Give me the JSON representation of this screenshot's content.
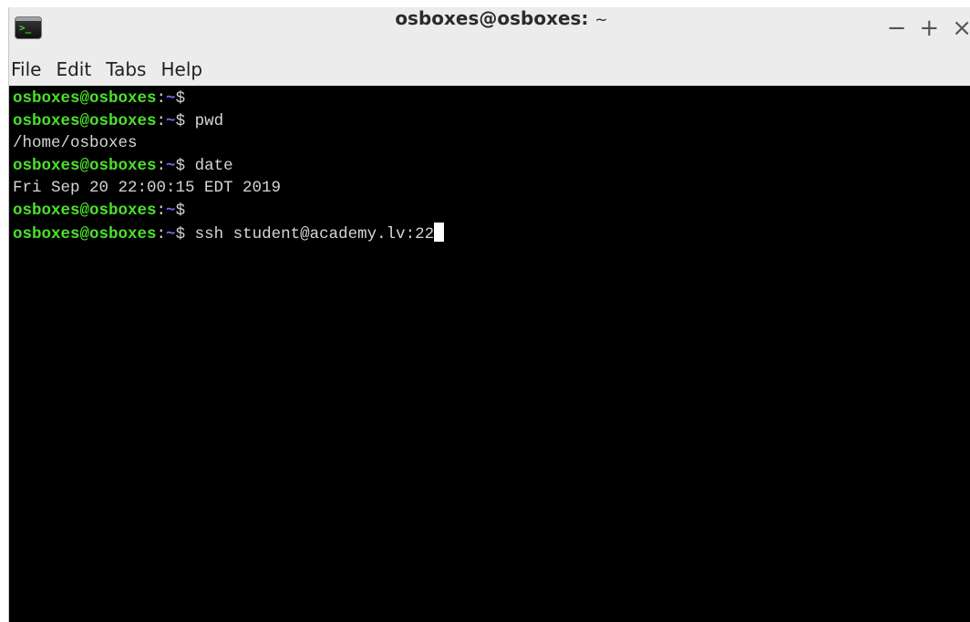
{
  "window": {
    "title_main": "osboxes@osboxes:",
    "title_suffix": "~",
    "controls": {
      "minimize": "−",
      "maximize": "+",
      "close": "×"
    }
  },
  "menu": {
    "file": "File",
    "edit": "Edit",
    "tabs": "Tabs",
    "help": "Help"
  },
  "terminal": {
    "prompt": {
      "user_host": "osboxes@osboxes",
      "separator": ":",
      "path": "~",
      "symbol": "$"
    },
    "lines": [
      {
        "type": "prompt",
        "command": ""
      },
      {
        "type": "prompt",
        "command": " pwd"
      },
      {
        "type": "output",
        "text": "/home/osboxes"
      },
      {
        "type": "prompt",
        "command": " date"
      },
      {
        "type": "output",
        "text": "Fri Sep 20 22:00:15 EDT 2019"
      },
      {
        "type": "prompt",
        "command": ""
      },
      {
        "type": "prompt",
        "command": " ssh student@academy.lv:22",
        "cursor": true
      }
    ]
  },
  "colors": {
    "user_host": "#4be02c",
    "path": "#6e6ef5",
    "text": "#d6d6d6",
    "background": "#000000"
  }
}
